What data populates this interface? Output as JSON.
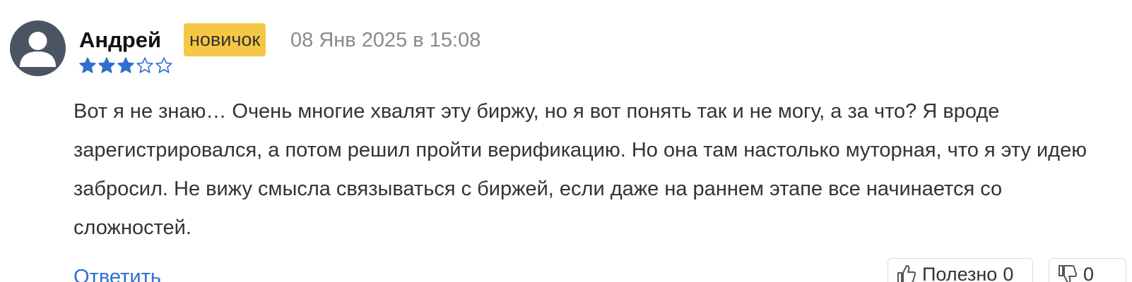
{
  "comment": {
    "author": "Андрей",
    "badge": "новичок",
    "date": "08 Янв 2025 в 15:08",
    "rating": 3,
    "rating_max": 5,
    "text": "Вот я не знаю… Очень многие хвалят эту биржу, но я вот понять так и не могу, а за что? Я вроде зарегистрировался, а потом решил пройти верификацию. Но она там настолько муторная, что я эту идею забросил. Не вижу смысла связываться с биржей, если даже на раннем этапе все начинается со сложностей."
  },
  "actions": {
    "reply_label": "Ответить",
    "helpful_label": "Полезно",
    "helpful_count": "0",
    "unhelpful_count": "0"
  },
  "colors": {
    "badge_bg": "#f6c744",
    "star": "#2f6fd0",
    "link": "#2f6fd0",
    "avatar_bg": "#4a5463"
  },
  "icons": {
    "avatar": "user-silhouette-icon",
    "star": "star-icon",
    "like": "thumbs-up-icon",
    "dislike": "thumbs-down-icon"
  }
}
